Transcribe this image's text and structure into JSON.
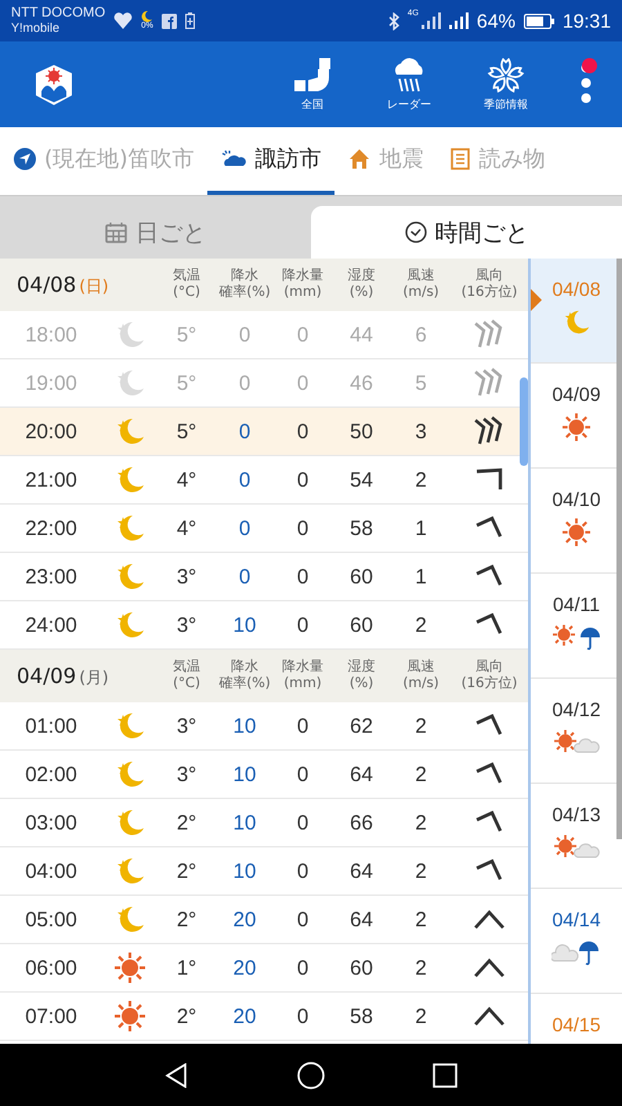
{
  "status_bar": {
    "carrier": "NTT DOCOMO",
    "carrier_2": "Y!mobile",
    "moon_percent": "0%",
    "network": "4G",
    "battery": "64%",
    "time": "19:31"
  },
  "app_bar": {
    "actions": [
      {
        "kind": "japan",
        "label": "全国"
      },
      {
        "kind": "radar",
        "label": "レーダー"
      },
      {
        "kind": "season",
        "label": "季節情報"
      }
    ],
    "menu_badge": true
  },
  "location_tabs": [
    {
      "kind": "location",
      "label": "(現在地)笛吹市",
      "selected": false
    },
    {
      "kind": "weather",
      "label": "諏訪市",
      "selected": true
    },
    {
      "kind": "quake",
      "label": "地震",
      "selected": false
    },
    {
      "kind": "reading",
      "label": "読み物",
      "selected": false
    }
  ],
  "view_tabs": [
    {
      "kind": "calendar",
      "label": "日ごと",
      "selected": false
    },
    {
      "kind": "clock",
      "label": "時間ごと",
      "selected": true
    }
  ],
  "days": [
    {
      "date": "04/08",
      "weekday": "(日)",
      "color": "#e07b1c",
      "columns": [
        {
          "line1": "気温",
          "line2": "(°C)"
        },
        {
          "line1": "降水",
          "line2": "確率(%)"
        },
        {
          "line1": "降水量",
          "line2": "(mm)"
        },
        {
          "line1": "湿度",
          "line2": "(%)"
        },
        {
          "line1": "風速",
          "line2": "(m/s)"
        },
        {
          "line1": "風向",
          "line2": "(16方位)"
        }
      ],
      "hours": [
        {
          "time": "18:00",
          "weather": {
            "kind": "moon"
          },
          "temp": "5°",
          "prob": "0",
          "amount": "0",
          "humidity": "44",
          "speed": "6",
          "wind": {
            "kind": "triple"
          },
          "past": true,
          "current": false
        },
        {
          "time": "19:00",
          "weather": {
            "kind": "moon"
          },
          "temp": "5°",
          "prob": "0",
          "amount": "0",
          "humidity": "46",
          "speed": "5",
          "wind": {
            "kind": "triple"
          },
          "past": true,
          "current": false
        },
        {
          "time": "20:00",
          "weather": {
            "kind": "moon"
          },
          "temp": "5°",
          "prob": "0",
          "amount": "0",
          "humidity": "50",
          "speed": "3",
          "wind": {
            "kind": "triple"
          },
          "past": false,
          "current": true
        },
        {
          "time": "21:00",
          "weather": {
            "kind": "moon"
          },
          "temp": "4°",
          "prob": "0",
          "amount": "0",
          "humidity": "54",
          "speed": "2",
          "wind": {
            "kind": "hook"
          },
          "past": false,
          "current": false
        },
        {
          "time": "22:00",
          "weather": {
            "kind": "moon"
          },
          "temp": "4°",
          "prob": "0",
          "amount": "0",
          "humidity": "58",
          "speed": "1",
          "wind": {
            "kind": "bend"
          },
          "past": false,
          "current": false
        },
        {
          "time": "23:00",
          "weather": {
            "kind": "moon"
          },
          "temp": "3°",
          "prob": "0",
          "amount": "0",
          "humidity": "60",
          "speed": "1",
          "wind": {
            "kind": "bend"
          },
          "past": false,
          "current": false
        },
        {
          "time": "24:00",
          "weather": {
            "kind": "moon"
          },
          "temp": "3°",
          "prob": "10",
          "amount": "0",
          "humidity": "60",
          "speed": "2",
          "wind": {
            "kind": "bend"
          },
          "past": false,
          "current": false
        }
      ]
    },
    {
      "date": "04/09",
      "weekday": "(月)",
      "color": "#666666",
      "columns": [
        {
          "line1": "気温",
          "line2": "(°C)"
        },
        {
          "line1": "降水",
          "line2": "確率(%)"
        },
        {
          "line1": "降水量",
          "line2": "(mm)"
        },
        {
          "line1": "湿度",
          "line2": "(%)"
        },
        {
          "line1": "風速",
          "line2": "(m/s)"
        },
        {
          "line1": "風向",
          "line2": "(16方位)"
        }
      ],
      "hours": [
        {
          "time": "01:00",
          "weather": {
            "kind": "moon"
          },
          "temp": "3°",
          "prob": "10",
          "amount": "0",
          "humidity": "62",
          "speed": "2",
          "wind": {
            "kind": "bend"
          },
          "past": false,
          "current": false
        },
        {
          "time": "02:00",
          "weather": {
            "kind": "moon"
          },
          "temp": "3°",
          "prob": "10",
          "amount": "0",
          "humidity": "64",
          "speed": "2",
          "wind": {
            "kind": "bend"
          },
          "past": false,
          "current": false
        },
        {
          "time": "03:00",
          "weather": {
            "kind": "moon"
          },
          "temp": "2°",
          "prob": "10",
          "amount": "0",
          "humidity": "66",
          "speed": "2",
          "wind": {
            "kind": "bend"
          },
          "past": false,
          "current": false
        },
        {
          "time": "04:00",
          "weather": {
            "kind": "moon"
          },
          "temp": "2°",
          "prob": "10",
          "amount": "0",
          "humidity": "64",
          "speed": "2",
          "wind": {
            "kind": "bend"
          },
          "past": false,
          "current": false
        },
        {
          "time": "05:00",
          "weather": {
            "kind": "moon"
          },
          "temp": "2°",
          "prob": "20",
          "amount": "0",
          "humidity": "64",
          "speed": "2",
          "wind": {
            "kind": "caret"
          },
          "past": false,
          "current": false
        },
        {
          "time": "06:00",
          "weather": {
            "kind": "sun"
          },
          "temp": "1°",
          "prob": "20",
          "amount": "0",
          "humidity": "60",
          "speed": "2",
          "wind": {
            "kind": "caret"
          },
          "past": false,
          "current": false
        },
        {
          "time": "07:00",
          "weather": {
            "kind": "sun"
          },
          "temp": "2°",
          "prob": "20",
          "amount": "0",
          "humidity": "58",
          "speed": "2",
          "wind": {
            "kind": "caret"
          },
          "past": false,
          "current": false
        }
      ]
    }
  ],
  "daily": [
    {
      "date": "04/08",
      "color": "#e07b1c",
      "weather": {
        "kind": "moon"
      },
      "selected": true
    },
    {
      "date": "04/09",
      "color": "#333333",
      "weather": {
        "kind": "sun"
      },
      "selected": false
    },
    {
      "date": "04/10",
      "color": "#333333",
      "weather": {
        "kind": "sun"
      },
      "selected": false
    },
    {
      "date": "04/11",
      "color": "#333333",
      "weather": {
        "kind": "sun-rain"
      },
      "selected": false
    },
    {
      "date": "04/12",
      "color": "#333333",
      "weather": {
        "kind": "sun-cloud"
      },
      "selected": false
    },
    {
      "date": "04/13",
      "color": "#333333",
      "weather": {
        "kind": "sun-cloud"
      },
      "selected": false
    },
    {
      "date": "04/14",
      "color": "#1a5fb4",
      "weather": {
        "kind": "cloud-rain"
      },
      "selected": false
    },
    {
      "date": "04/15",
      "color": "#e07b1c",
      "selected": false
    }
  ]
}
